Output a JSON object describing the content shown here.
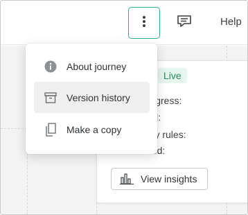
{
  "header": {
    "more_icon": "vertical-dots-icon",
    "feedback_icon": "feedback-icon",
    "help_label": "Help"
  },
  "menu": {
    "items": [
      {
        "label": "About journey",
        "icon": "info-icon",
        "highlighted": false
      },
      {
        "label": "Version history",
        "icon": "archive-box-icon",
        "highlighted": true
      },
      {
        "label": "Make a copy",
        "icon": "copy-icon",
        "highlighted": false
      }
    ]
  },
  "card": {
    "status_badge": "Live",
    "stats": [
      "progress:",
      "rted:",
      "d by rules:",
      "shed:"
    ],
    "insights_label": "View insights",
    "insights_icon": "bar-chart-icon"
  },
  "colors": {
    "accent": "#2fae90",
    "live_bg": "#e6f6ef",
    "live_text": "#238a63"
  }
}
